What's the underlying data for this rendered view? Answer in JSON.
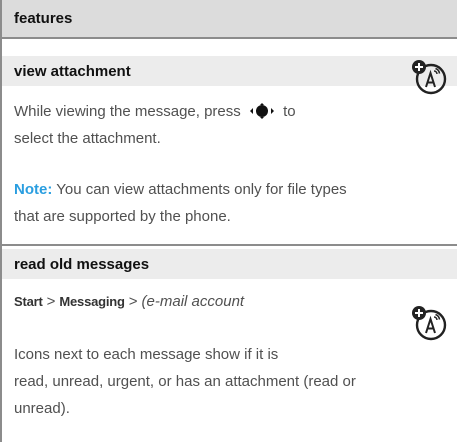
{
  "header": {
    "title": "features"
  },
  "section1": {
    "title": "view attachment",
    "line1_pre": "While viewing the message, press",
    "line1_post": "to",
    "line2": "select the attachment.",
    "note_label": "Note:",
    "note_line1": " You can view attachments only for file types",
    "note_line2": "that are supported by the phone.",
    "icon": "network-dependent-feature-icon"
  },
  "section2": {
    "title": "read old messages",
    "path_start": "Start",
    "path_sep": ">",
    "path_messaging": "Messaging",
    "path_sep2": ">",
    "path_account": "(e-mail account",
    "line1": "Icons next to each message show if it is",
    "line2": "read, unread, urgent, or has an attachment (read or",
    "line3": "unread).",
    "icon": "network-dependent-feature-icon"
  },
  "colors": {
    "note_accent": "#2a9ee0",
    "header_bg": "#dcdcdc",
    "band_bg": "#ececec",
    "rule": "#8c8c8c"
  }
}
